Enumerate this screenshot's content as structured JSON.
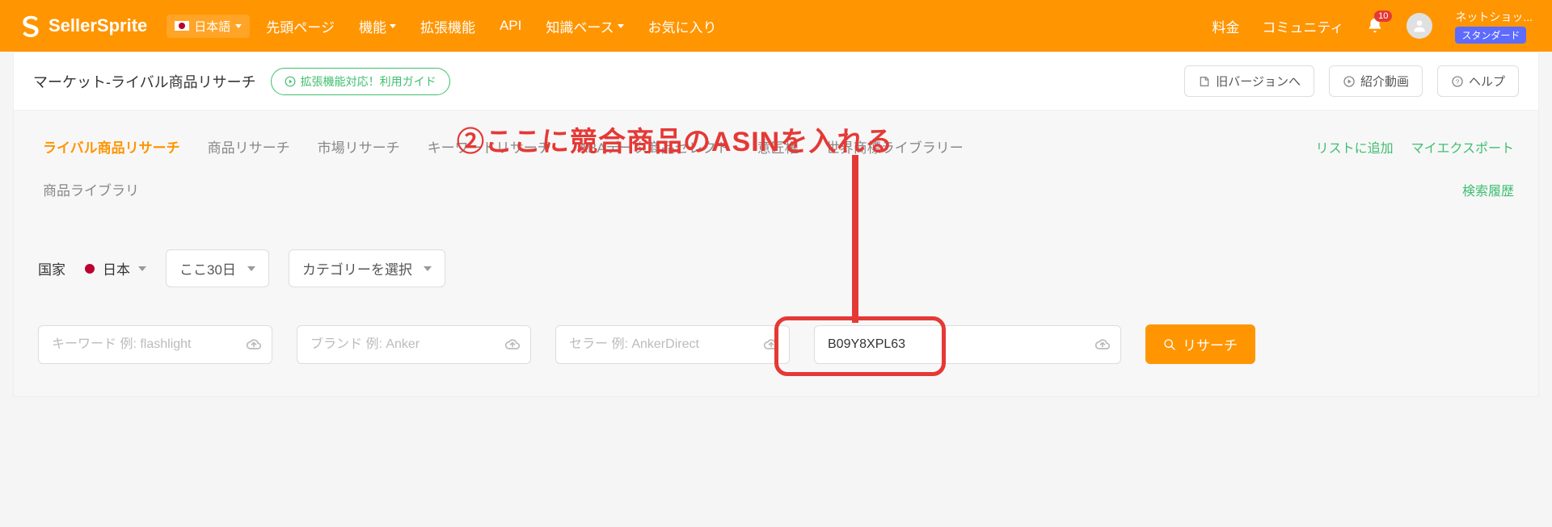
{
  "brand": "SellerSprite",
  "language": {
    "label": "日本語"
  },
  "nav": {
    "top": "先頭ページ",
    "features": "機能",
    "extensions": "拡張機能",
    "api": "API",
    "kb": "知識ベース",
    "favorites": "お気に入り",
    "pricing": "料金",
    "community": "コミュニティ"
  },
  "notifications": {
    "count": "10"
  },
  "user": {
    "name": "ネットショッ...",
    "plan": "スタンダード"
  },
  "page": {
    "title": "マーケット-ライバル商品リサーチ",
    "ext_button": "拡張機能対応！利用ガイド",
    "old_version": "旧バージョンへ",
    "intro_video": "紹介動画",
    "help": "ヘルプ"
  },
  "annotation": "②ここに競合商品のASINを入れる",
  "tabs": {
    "rival": "ライバル商品リサーチ",
    "product": "商品リサーチ",
    "market": "市場リサーチ",
    "keyword": "キーワードリサーチ",
    "aba": "ABAデータ商品セレクト",
    "design": "意匠権",
    "trademark": "世界商標ライブラリー",
    "library": "商品ライブラリ"
  },
  "side_links": {
    "add_list": "リストに追加",
    "my_export": "マイエクスポート",
    "search_history": "検索履歴"
  },
  "controls": {
    "country_label": "国家",
    "country_value": "日本",
    "period": "ここ30日",
    "category": "カテゴリーを選択"
  },
  "inputs": {
    "keyword_ph": "キーワード 例: flashlight",
    "brand_ph": "ブランド 例: Anker",
    "seller_ph": "セラー 例: AnkerDirect",
    "asin_value": "B09Y8XPL63"
  },
  "buttons": {
    "research": "リサーチ"
  }
}
